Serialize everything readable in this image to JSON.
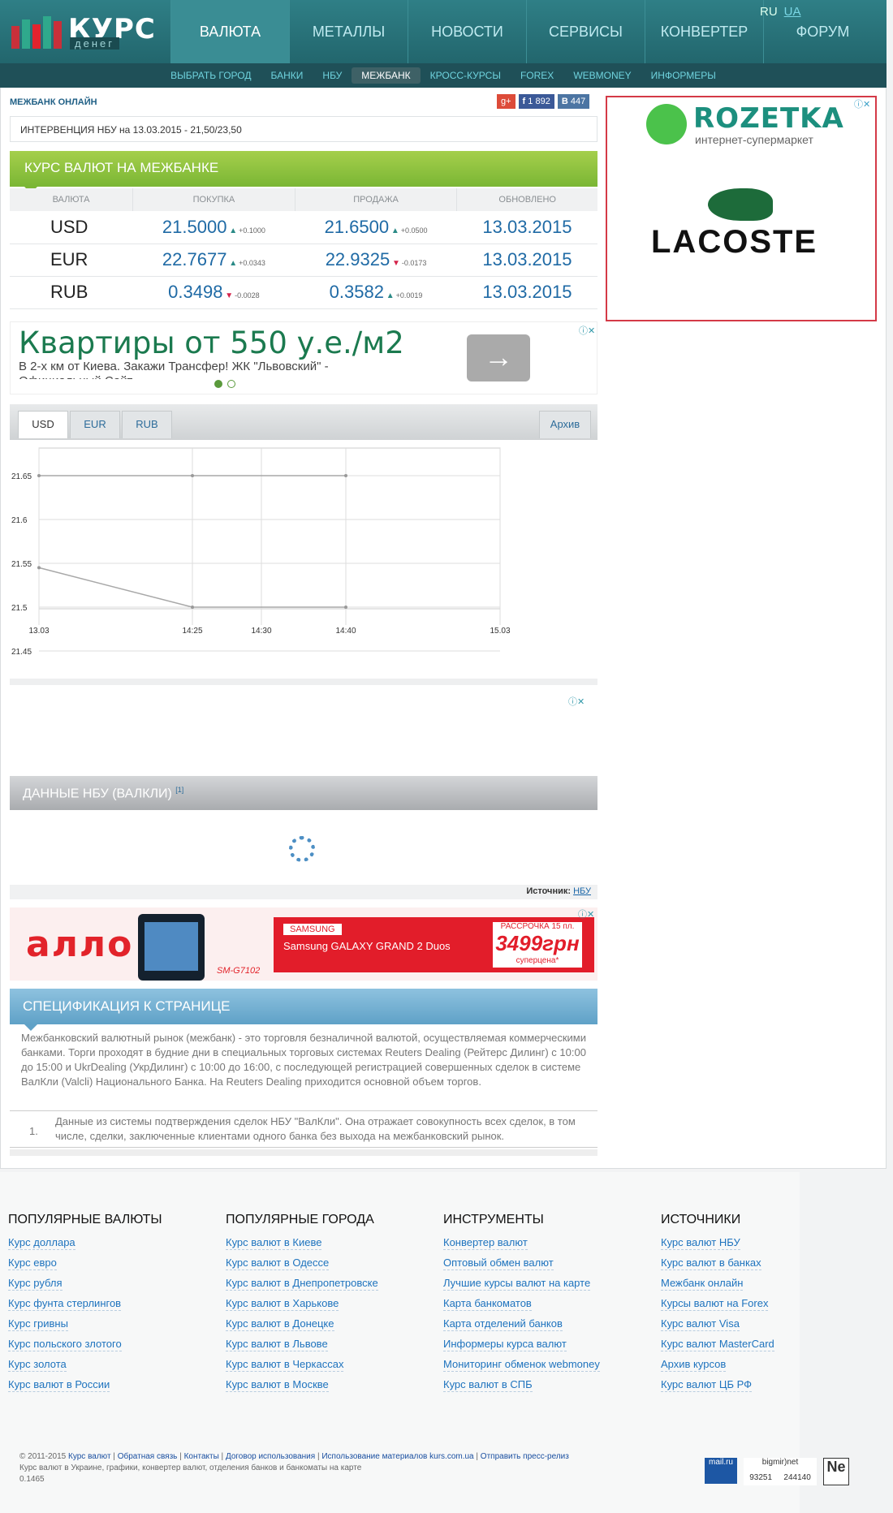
{
  "header": {
    "logo_title": "КУРС",
    "logo_sub": "денег",
    "nav": [
      "ВАЛЮТА",
      "МЕТАЛЛЫ",
      "НОВОСТИ",
      "СЕРВИСЫ",
      "КОНВЕРТЕР",
      "ФОРУМ"
    ],
    "lang_ru": "RU",
    "lang_ua": "UA",
    "subnav": [
      "ВЫБРАТЬ ГОРОД",
      "БАНКИ",
      "НБУ",
      "МЕЖБАНК",
      "КРОСС-КУРСЫ",
      "FOREX",
      "WEBMONEY",
      "ИНФОРМЕРЫ"
    ]
  },
  "main": {
    "section_title": "МЕЖБАНК ОНЛАЙН",
    "social": {
      "fb": "1 892",
      "vk": "447"
    },
    "intervention": "ИНТЕРВЕНЦИЯ НБУ на 13.03.2015 - 21,50/23,50",
    "rates_title": "КУРС ВАЛЮТ НА МЕЖБАНКЕ",
    "rate_headers": [
      "ВАЛЮТА",
      "ПОКУПКА",
      "ПРОДАЖА",
      "ОБНОВЛЕНО"
    ],
    "rates": [
      {
        "cur": "USD",
        "buy": "21.5000",
        "buy_d": "+0.1000",
        "buy_dir": "up",
        "sell": "21.6500",
        "sell_d": "+0.0500",
        "sell_dir": "up",
        "date": "13.03.2015"
      },
      {
        "cur": "EUR",
        "buy": "22.7677",
        "buy_d": "+0.0343",
        "buy_dir": "up",
        "sell": "22.9325",
        "sell_d": "-0.0173",
        "sell_dir": "dn",
        "date": "13.03.2015"
      },
      {
        "cur": "RUB",
        "buy": "0.3498",
        "buy_d": "-0.0028",
        "buy_dir": "dn",
        "sell": "0.3582",
        "sell_d": "+0.0019",
        "sell_dir": "up",
        "date": "13.03.2015"
      }
    ],
    "ad1_title": "Квартиры от 550 у.е./м2",
    "ad1_desc": "В 2-х км от Киева. Закажи Трансфер! ЖК \"Львовский\" -",
    "ad1_desc2": "Официальный Сайт",
    "tabs": [
      "USD",
      "EUR",
      "RUB"
    ],
    "archive": "Архив",
    "nbu_title": "ДАННЫЕ НБУ (ВАЛКЛИ)",
    "nbu_sup": "[1]",
    "source_label": "Источник:",
    "source_link": "НБУ",
    "spec_title": "СПЕЦИФИКАЦИЯ К СТРАНИЦЕ",
    "spec_text": "Межбанковский валютный рынок (межбанк) - это торговля безналичной валютой, осуществляемая коммерческими банками. Торги проходят в будние дни в специальных торговых системах Reuters Dealing (Рейтерс Дилинг) с 10:00 до 15:00 и UkrDealing (УкрДилинг) с 10:00 до 16:00, с последующей регистрацией совершенных сделок в системе ВалКли (Valcli) Национального Банка. На Reuters Dealing приходится основной объем торгов.",
    "note_num": "1.",
    "note_text": "Данные из системы подтверждения сделок НБУ \"ВалКли\". Она отражает совокупность всех сделок, в том числе, сделки, заключенные клиентами одного банка без выхода на межбанковский рынок."
  },
  "ads": {
    "rozetka": "ROZETKA",
    "rozetka_tag": "интернет-супермаркет",
    "lacoste": "LACOSTE",
    "allo": "алло",
    "allo_model": "SM-G7102",
    "allo_brand": "SAMSUNG",
    "allo_galaxy": "Samsung GALAXY GRAND 2 Duos",
    "allo_installment": "РАССРОЧКА 15 пл.",
    "allo_price": "3499грн",
    "allo_super": "суперцена*"
  },
  "chart_data": {
    "type": "line",
    "x": [
      "13.03",
      "14:25",
      "14:30",
      "14:40",
      "15.03"
    ],
    "y_ticks": [
      "21.65",
      "21.6",
      "21.55",
      "21.5",
      "21.45"
    ],
    "ylim": [
      21.45,
      21.65
    ],
    "series": [
      {
        "values": [
          [
            0,
            21.65
          ],
          [
            1,
            21.65
          ],
          [
            3,
            21.65
          ]
        ]
      },
      {
        "values": [
          [
            0,
            21.545
          ],
          [
            1,
            21.5
          ],
          [
            3,
            21.5
          ]
        ]
      }
    ]
  },
  "footer": {
    "cols": [
      {
        "title": "ПОПУЛЯРНЫЕ ВАЛЮТЫ",
        "links": [
          "Курс доллара",
          "Курс евро",
          "Курс рубля",
          "Курс фунта стерлингов",
          "Курс гривны",
          "Курс польского злотого",
          "Курс золота",
          "Курс валют в России"
        ]
      },
      {
        "title": "ПОПУЛЯРНЫЕ ГОРОДА",
        "links": [
          "Курс валют в Киеве",
          "Курс валют в Одессе",
          "Курс валют в Днепропетровске",
          "Курс валют в Харькове",
          "Курс валют в Донецке",
          "Курс валют в Львове",
          "Курс валют в Черкассах",
          "Курс валют в Москве"
        ]
      },
      {
        "title": "ИНСТРУМЕНТЫ",
        "links": [
          "Конвертер валют",
          "Оптовый обмен валют",
          "Лучшие курсы валют на карте",
          "Карта банкоматов",
          "Карта отделений банков",
          "Информеры курса валют",
          "Мониторинг обменок webmoney",
          "Курс валют в СПБ"
        ]
      },
      {
        "title": "ИСТОЧНИКИ",
        "links": [
          "Курс валют НБУ",
          "Курс валют в банках",
          "Межбанк онлайн",
          "Курсы валют на Forex",
          "Курс валют Visa",
          "Курс валют MasterCard",
          "Архив курсов",
          "Курс валют ЦБ РФ"
        ]
      }
    ],
    "copyright": "© 2011-2015",
    "copy_links": [
      "Курс валют",
      "Обратная связь",
      "Контакты",
      "Договор использования",
      "Использование материалов kurs.com.ua",
      "Отправить пресс-релиз"
    ],
    "tagline": "Курс валют в Украине, графики, конвертер валют, отделения банков и банкоматы на карте",
    "version": "0.1465",
    "counter1": "mail.ru",
    "counter2": "bigmir)net",
    "counter2_a": "93251",
    "counter2_b": "244140",
    "counter3": "Ne"
  }
}
